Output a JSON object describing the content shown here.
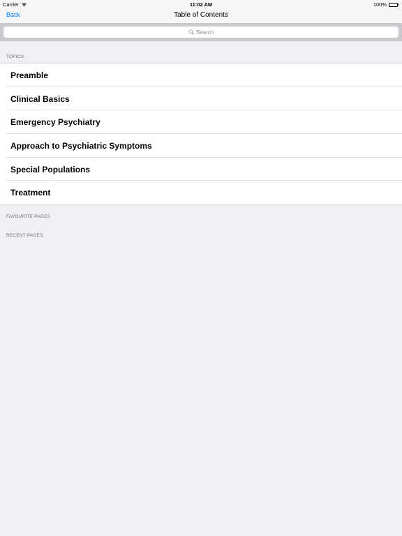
{
  "status_bar": {
    "carrier": "Carrier",
    "time": "11:02 AM",
    "battery": "100%"
  },
  "nav": {
    "back_label": "Back",
    "title": "Table of Contents"
  },
  "search": {
    "placeholder": "Search"
  },
  "sections": {
    "topics_header": "TOPICS",
    "favourites_header": "FAVOURITE PAGES",
    "recent_header": "RECENT PAGES"
  },
  "topics": [
    {
      "label": "Preamble"
    },
    {
      "label": "Clinical Basics"
    },
    {
      "label": "Emergency Psychiatry"
    },
    {
      "label": "Approach to Psychiatric Symptoms"
    },
    {
      "label": "Special Populations"
    },
    {
      "label": "Treatment"
    }
  ],
  "colors": {
    "accent": "#007aff",
    "background": "#efeff4",
    "search_bar_bg": "#c9c9ce",
    "section_header_text": "#6d6d72"
  },
  "icons": [
    "wifi-icon",
    "battery-icon",
    "search-icon"
  ]
}
